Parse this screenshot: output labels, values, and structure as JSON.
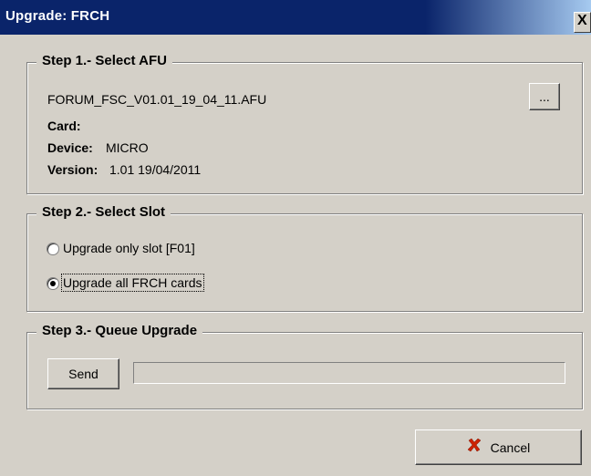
{
  "window": {
    "title": "Upgrade: FRCH",
    "close_glyph": "X"
  },
  "step1": {
    "legend": "Step 1.- Select AFU",
    "file_name": "FORUM_FSC_V01.01_19_04_11.AFU",
    "browse_label": "...",
    "card_label": "Card:",
    "card_value": "",
    "device_label": "Device:",
    "device_value": "MICRO",
    "version_label": "Version:",
    "version_value": "1.01 19/04/2011"
  },
  "step2": {
    "legend": "Step 2.- Select Slot",
    "options": [
      {
        "label": "Upgrade only slot [F01]",
        "selected": false
      },
      {
        "label": "Upgrade all FRCH cards",
        "selected": true
      }
    ]
  },
  "step3": {
    "legend": "Step 3.- Queue Upgrade",
    "send_label": "Send",
    "progress": 0
  },
  "footer": {
    "cancel_label": "Cancel",
    "cancel_icon": "red-x-icon",
    "cancel_icon_color": "#cc2200"
  }
}
